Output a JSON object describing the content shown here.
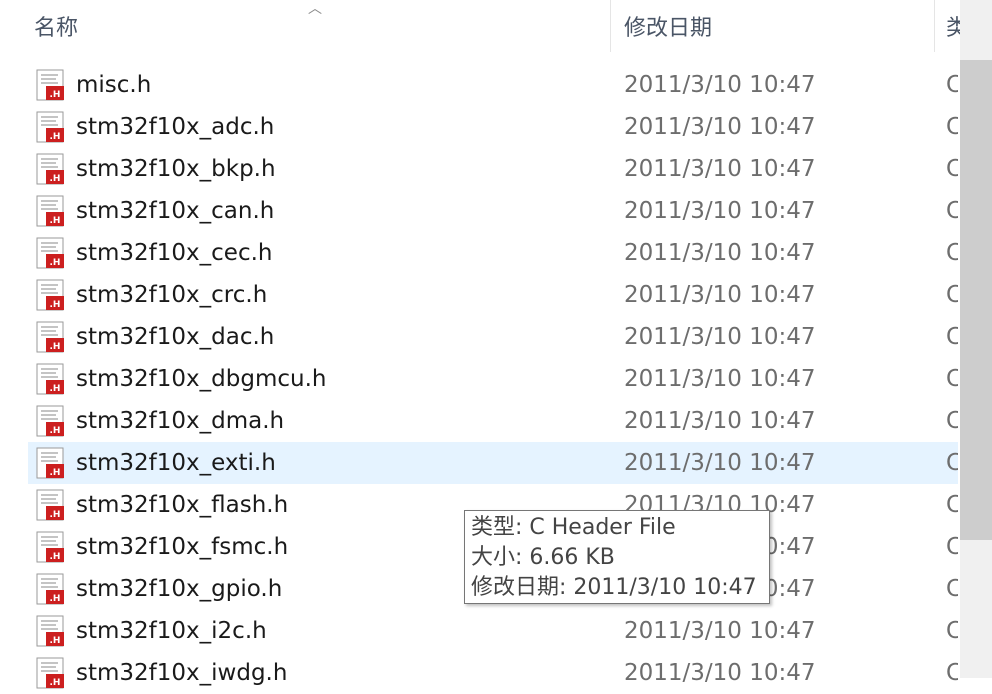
{
  "columns": {
    "name": "名称",
    "date_modified": "修改日期",
    "type": "类"
  },
  "files": [
    {
      "name": "misc.h",
      "date": "2011/3/10 10:47",
      "type": "C"
    },
    {
      "name": "stm32f10x_adc.h",
      "date": "2011/3/10 10:47",
      "type": "C"
    },
    {
      "name": "stm32f10x_bkp.h",
      "date": "2011/3/10 10:47",
      "type": "C"
    },
    {
      "name": "stm32f10x_can.h",
      "date": "2011/3/10 10:47",
      "type": "C"
    },
    {
      "name": "stm32f10x_cec.h",
      "date": "2011/3/10 10:47",
      "type": "C"
    },
    {
      "name": "stm32f10x_crc.h",
      "date": "2011/3/10 10:47",
      "type": "C"
    },
    {
      "name": "stm32f10x_dac.h",
      "date": "2011/3/10 10:47",
      "type": "C"
    },
    {
      "name": "stm32f10x_dbgmcu.h",
      "date": "2011/3/10 10:47",
      "type": "C"
    },
    {
      "name": "stm32f10x_dma.h",
      "date": "2011/3/10 10:47",
      "type": "C"
    },
    {
      "name": "stm32f10x_exti.h",
      "date": "2011/3/10 10:47",
      "type": "C"
    },
    {
      "name": "stm32f10x_flash.h",
      "date": "2011/3/10 10:47",
      "type": "C"
    },
    {
      "name": "stm32f10x_fsmc.h",
      "date": "2011/3/10 10:47",
      "type": "C"
    },
    {
      "name": "stm32f10x_gpio.h",
      "date": "2011/3/10 10:47",
      "type": "C"
    },
    {
      "name": "stm32f10x_i2c.h",
      "date": "2011/3/10 10:47",
      "type": "C"
    },
    {
      "name": "stm32f10x_iwdg.h",
      "date": "2011/3/10 10:47",
      "type": "C"
    }
  ],
  "hovered_file": "stm32f10x_exti.h",
  "tooltip": {
    "type_line": "类型: C Header File",
    "size_line": "大小: 6.66 KB",
    "date_line": "修改日期: 2011/3/10 10:47"
  },
  "icon": "c-header-file-icon",
  "colors": {
    "hover_row": "#e5f3ff",
    "icon_red": "#cc1f1f",
    "header_text": "#4a5566"
  }
}
